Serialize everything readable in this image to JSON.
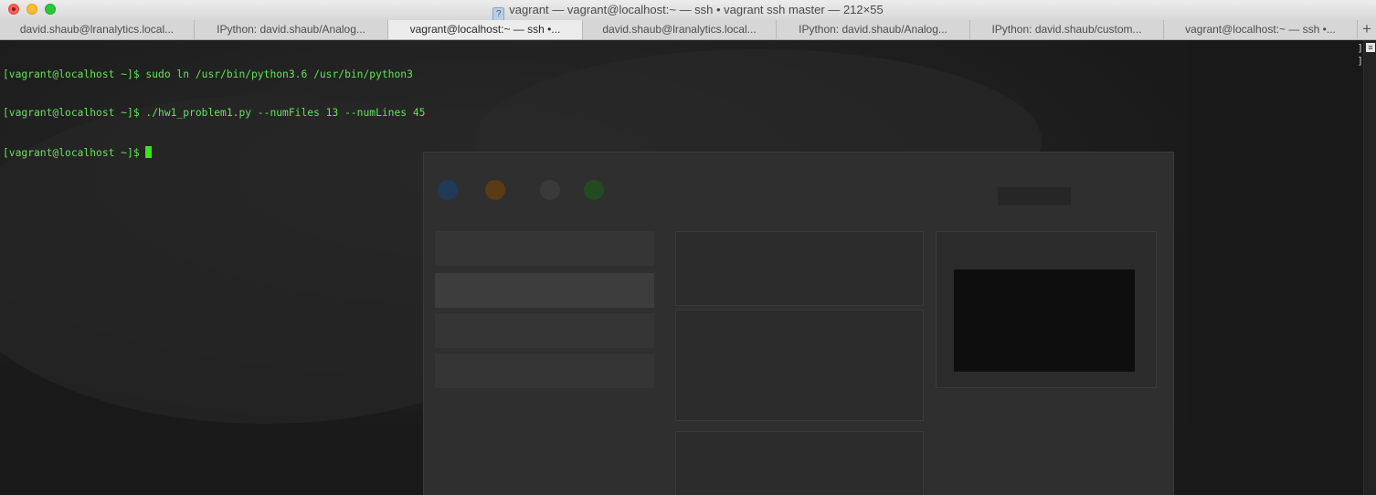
{
  "window": {
    "title": "vagrant — vagrant@localhost:~ — ssh • vagrant ssh master — 212×55",
    "title_icon": "question-doc-icon"
  },
  "tabs": [
    {
      "label": "david.shaub@lranalytics.local..."
    },
    {
      "label": "IPython: david.shaub/Analog..."
    },
    {
      "label": "vagrant@localhost:~ — ssh •..."
    },
    {
      "label": "david.shaub@lranalytics.local..."
    },
    {
      "label": "IPython: david.shaub/Analog..."
    },
    {
      "label": "IPython: david.shaub/custom..."
    },
    {
      "label": "vagrant@localhost:~ — ssh •..."
    }
  ],
  "active_tab_index": 2,
  "new_tab_label": "+",
  "terminal": {
    "lines": [
      "[vagrant@localhost ~]$ sudo ln /usr/bin/python3.6 /usr/bin/python3",
      "[vagrant@localhost ~]$ ./hw1_problem1.py --numFiles 13 --numLines 45",
      "[vagrant@localhost ~]$ "
    ],
    "text_color": "#63e35a",
    "cursor_color": "#39e51b",
    "background": "#191919"
  }
}
